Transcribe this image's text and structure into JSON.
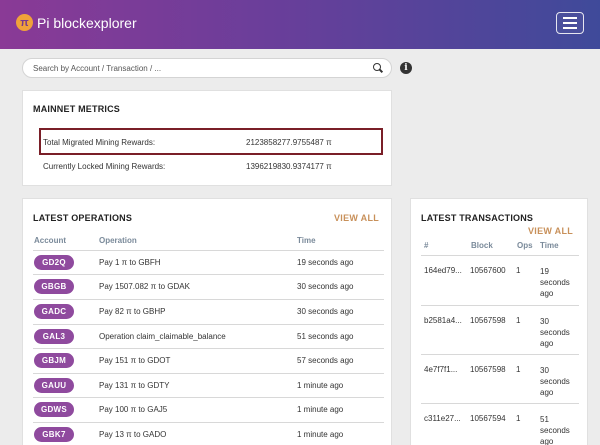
{
  "header": {
    "brand": "Pi blockexplorer",
    "logo_glyph": "π",
    "menu_icon": "hamburger-icon"
  },
  "search": {
    "placeholder": "Search by Account / Transaction / ..."
  },
  "metrics": {
    "title": "MAINNET METRICS",
    "rows": [
      {
        "label": "Total Migrated Mining Rewards:",
        "value": "2123858277.9755487 π"
      },
      {
        "label": "Currently Locked Mining Rewards:",
        "value": "1396219830.9374177 π"
      }
    ]
  },
  "operations": {
    "title": "LATEST OPERATIONS",
    "view_all": "VIEW ALL",
    "headers": [
      "Account",
      "Operation",
      "Time"
    ],
    "rows": [
      {
        "account": "GD2Q",
        "operation": "Pay 1 π to GBFH",
        "time": "19 seconds ago"
      },
      {
        "account": "GBGB",
        "operation": "Pay 1507.082 π to GDAK",
        "time": "30 seconds ago"
      },
      {
        "account": "GADC",
        "operation": "Pay 82 π to GBHP",
        "time": "30 seconds ago"
      },
      {
        "account": "GAL3",
        "operation": "Operation claim_claimable_balance",
        "time": "51 seconds ago"
      },
      {
        "account": "GBJM",
        "operation": "Pay 151 π to GDOT",
        "time": "57 seconds ago"
      },
      {
        "account": "GAUU",
        "operation": "Pay 131 π to GDTY",
        "time": "1 minute ago"
      },
      {
        "account": "GDWS",
        "operation": "Pay 100 π to GAJ5",
        "time": "1 minute ago"
      },
      {
        "account": "GBK7",
        "operation": "Pay 13 π to GADO",
        "time": "1 minute ago"
      }
    ]
  },
  "transactions": {
    "title": "LATEST TRANSACTIONS",
    "view_all": "VIEW ALL",
    "headers": [
      "#",
      "Block",
      "Ops",
      "Time"
    ],
    "rows": [
      {
        "hash": "164ed79...",
        "block": "10567600",
        "ops": "1",
        "time": "19 seconds ago"
      },
      {
        "hash": "b2581a4...",
        "block": "10567598",
        "ops": "1",
        "time": "30 seconds ago"
      },
      {
        "hash": "4e7f7f1...",
        "block": "10567598",
        "ops": "1",
        "time": "30 seconds ago"
      },
      {
        "hash": "c311e27...",
        "block": "10567594",
        "ops": "1",
        "time": "51 seconds ago"
      }
    ]
  },
  "colors": {
    "accent_badge": "#8f4a9e",
    "view_all": "#c8905a",
    "highlight_box": "#7a1f28"
  }
}
